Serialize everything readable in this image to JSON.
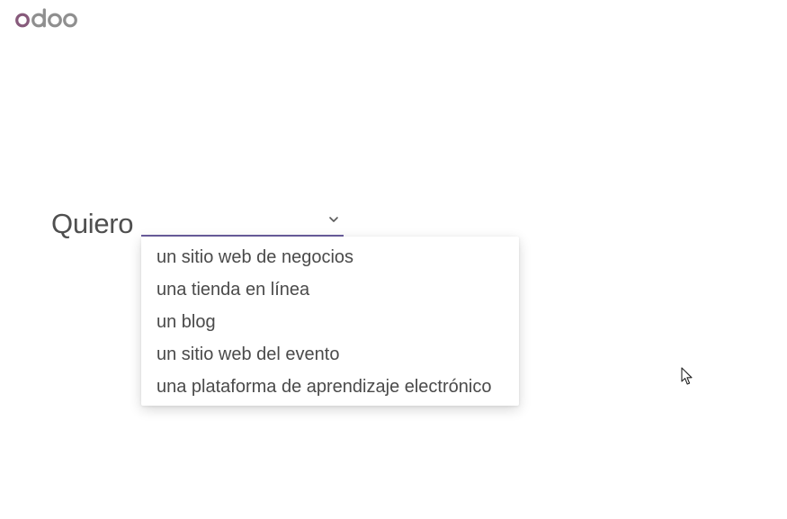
{
  "logo": {
    "text": "odoo"
  },
  "prompt": {
    "lead": "Quiero",
    "selected_value": ""
  },
  "dropdown": {
    "options": [
      {
        "label": "un sitio web de negocios"
      },
      {
        "label": "una tienda en línea"
      },
      {
        "label": "un blog"
      },
      {
        "label": "un sitio web del evento"
      },
      {
        "label": "una plataforma de aprendizaje electrónico"
      }
    ]
  },
  "colors": {
    "accent": "#6b5d9e",
    "logo_o": "#875a7b",
    "logo_rest": "#8f8f8f",
    "text": "#4a4a4a"
  },
  "icons": {
    "dropdown": "chevron-down-icon",
    "pointer": "mouse-cursor-icon"
  }
}
